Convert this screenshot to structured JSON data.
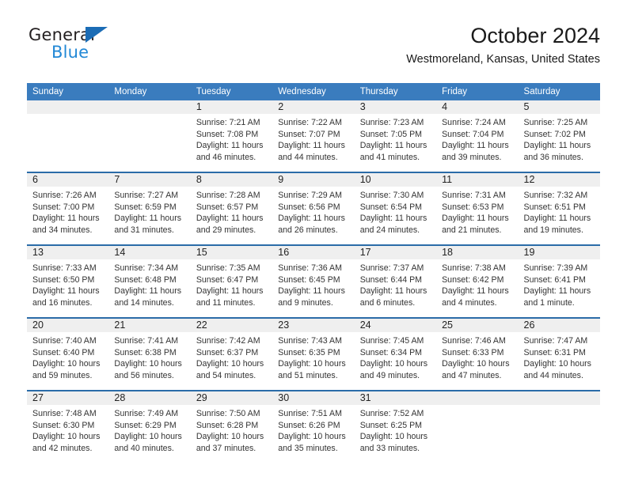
{
  "brand": {
    "name_top": "General",
    "name_bottom": "Blue",
    "triangle_color": "#1b6cb5",
    "blue_text_color": "#2288d6"
  },
  "header": {
    "month_title": "October 2024",
    "location": "Westmoreland, Kansas, United States"
  },
  "theme": {
    "header_band": "#3a7cbe",
    "row_divider": "#2b6ca8",
    "daynum_band": "#efefef"
  },
  "calendar": {
    "weekday_headers": [
      "Sunday",
      "Monday",
      "Tuesday",
      "Wednesday",
      "Thursday",
      "Friday",
      "Saturday"
    ],
    "weeks": [
      [
        {
          "day": "",
          "sunrise": "",
          "sunset": "",
          "daylight_line1": "",
          "daylight_line2": ""
        },
        {
          "day": "",
          "sunrise": "",
          "sunset": "",
          "daylight_line1": "",
          "daylight_line2": ""
        },
        {
          "day": "1",
          "sunrise": "Sunrise: 7:21 AM",
          "sunset": "Sunset: 7:08 PM",
          "daylight_line1": "Daylight: 11 hours",
          "daylight_line2": "and 46 minutes."
        },
        {
          "day": "2",
          "sunrise": "Sunrise: 7:22 AM",
          "sunset": "Sunset: 7:07 PM",
          "daylight_line1": "Daylight: 11 hours",
          "daylight_line2": "and 44 minutes."
        },
        {
          "day": "3",
          "sunrise": "Sunrise: 7:23 AM",
          "sunset": "Sunset: 7:05 PM",
          "daylight_line1": "Daylight: 11 hours",
          "daylight_line2": "and 41 minutes."
        },
        {
          "day": "4",
          "sunrise": "Sunrise: 7:24 AM",
          "sunset": "Sunset: 7:04 PM",
          "daylight_line1": "Daylight: 11 hours",
          "daylight_line2": "and 39 minutes."
        },
        {
          "day": "5",
          "sunrise": "Sunrise: 7:25 AM",
          "sunset": "Sunset: 7:02 PM",
          "daylight_line1": "Daylight: 11 hours",
          "daylight_line2": "and 36 minutes."
        }
      ],
      [
        {
          "day": "6",
          "sunrise": "Sunrise: 7:26 AM",
          "sunset": "Sunset: 7:00 PM",
          "daylight_line1": "Daylight: 11 hours",
          "daylight_line2": "and 34 minutes."
        },
        {
          "day": "7",
          "sunrise": "Sunrise: 7:27 AM",
          "sunset": "Sunset: 6:59 PM",
          "daylight_line1": "Daylight: 11 hours",
          "daylight_line2": "and 31 minutes."
        },
        {
          "day": "8",
          "sunrise": "Sunrise: 7:28 AM",
          "sunset": "Sunset: 6:57 PM",
          "daylight_line1": "Daylight: 11 hours",
          "daylight_line2": "and 29 minutes."
        },
        {
          "day": "9",
          "sunrise": "Sunrise: 7:29 AM",
          "sunset": "Sunset: 6:56 PM",
          "daylight_line1": "Daylight: 11 hours",
          "daylight_line2": "and 26 minutes."
        },
        {
          "day": "10",
          "sunrise": "Sunrise: 7:30 AM",
          "sunset": "Sunset: 6:54 PM",
          "daylight_line1": "Daylight: 11 hours",
          "daylight_line2": "and 24 minutes."
        },
        {
          "day": "11",
          "sunrise": "Sunrise: 7:31 AM",
          "sunset": "Sunset: 6:53 PM",
          "daylight_line1": "Daylight: 11 hours",
          "daylight_line2": "and 21 minutes."
        },
        {
          "day": "12",
          "sunrise": "Sunrise: 7:32 AM",
          "sunset": "Sunset: 6:51 PM",
          "daylight_line1": "Daylight: 11 hours",
          "daylight_line2": "and 19 minutes."
        }
      ],
      [
        {
          "day": "13",
          "sunrise": "Sunrise: 7:33 AM",
          "sunset": "Sunset: 6:50 PM",
          "daylight_line1": "Daylight: 11 hours",
          "daylight_line2": "and 16 minutes."
        },
        {
          "day": "14",
          "sunrise": "Sunrise: 7:34 AM",
          "sunset": "Sunset: 6:48 PM",
          "daylight_line1": "Daylight: 11 hours",
          "daylight_line2": "and 14 minutes."
        },
        {
          "day": "15",
          "sunrise": "Sunrise: 7:35 AM",
          "sunset": "Sunset: 6:47 PM",
          "daylight_line1": "Daylight: 11 hours",
          "daylight_line2": "and 11 minutes."
        },
        {
          "day": "16",
          "sunrise": "Sunrise: 7:36 AM",
          "sunset": "Sunset: 6:45 PM",
          "daylight_line1": "Daylight: 11 hours",
          "daylight_line2": "and 9 minutes."
        },
        {
          "day": "17",
          "sunrise": "Sunrise: 7:37 AM",
          "sunset": "Sunset: 6:44 PM",
          "daylight_line1": "Daylight: 11 hours",
          "daylight_line2": "and 6 minutes."
        },
        {
          "day": "18",
          "sunrise": "Sunrise: 7:38 AM",
          "sunset": "Sunset: 6:42 PM",
          "daylight_line1": "Daylight: 11 hours",
          "daylight_line2": "and 4 minutes."
        },
        {
          "day": "19",
          "sunrise": "Sunrise: 7:39 AM",
          "sunset": "Sunset: 6:41 PM",
          "daylight_line1": "Daylight: 11 hours",
          "daylight_line2": "and 1 minute."
        }
      ],
      [
        {
          "day": "20",
          "sunrise": "Sunrise: 7:40 AM",
          "sunset": "Sunset: 6:40 PM",
          "daylight_line1": "Daylight: 10 hours",
          "daylight_line2": "and 59 minutes."
        },
        {
          "day": "21",
          "sunrise": "Sunrise: 7:41 AM",
          "sunset": "Sunset: 6:38 PM",
          "daylight_line1": "Daylight: 10 hours",
          "daylight_line2": "and 56 minutes."
        },
        {
          "day": "22",
          "sunrise": "Sunrise: 7:42 AM",
          "sunset": "Sunset: 6:37 PM",
          "daylight_line1": "Daylight: 10 hours",
          "daylight_line2": "and 54 minutes."
        },
        {
          "day": "23",
          "sunrise": "Sunrise: 7:43 AM",
          "sunset": "Sunset: 6:35 PM",
          "daylight_line1": "Daylight: 10 hours",
          "daylight_line2": "and 51 minutes."
        },
        {
          "day": "24",
          "sunrise": "Sunrise: 7:45 AM",
          "sunset": "Sunset: 6:34 PM",
          "daylight_line1": "Daylight: 10 hours",
          "daylight_line2": "and 49 minutes."
        },
        {
          "day": "25",
          "sunrise": "Sunrise: 7:46 AM",
          "sunset": "Sunset: 6:33 PM",
          "daylight_line1": "Daylight: 10 hours",
          "daylight_line2": "and 47 minutes."
        },
        {
          "day": "26",
          "sunrise": "Sunrise: 7:47 AM",
          "sunset": "Sunset: 6:31 PM",
          "daylight_line1": "Daylight: 10 hours",
          "daylight_line2": "and 44 minutes."
        }
      ],
      [
        {
          "day": "27",
          "sunrise": "Sunrise: 7:48 AM",
          "sunset": "Sunset: 6:30 PM",
          "daylight_line1": "Daylight: 10 hours",
          "daylight_line2": "and 42 minutes."
        },
        {
          "day": "28",
          "sunrise": "Sunrise: 7:49 AM",
          "sunset": "Sunset: 6:29 PM",
          "daylight_line1": "Daylight: 10 hours",
          "daylight_line2": "and 40 minutes."
        },
        {
          "day": "29",
          "sunrise": "Sunrise: 7:50 AM",
          "sunset": "Sunset: 6:28 PM",
          "daylight_line1": "Daylight: 10 hours",
          "daylight_line2": "and 37 minutes."
        },
        {
          "day": "30",
          "sunrise": "Sunrise: 7:51 AM",
          "sunset": "Sunset: 6:26 PM",
          "daylight_line1": "Daylight: 10 hours",
          "daylight_line2": "and 35 minutes."
        },
        {
          "day": "31",
          "sunrise": "Sunrise: 7:52 AM",
          "sunset": "Sunset: 6:25 PM",
          "daylight_line1": "Daylight: 10 hours",
          "daylight_line2": "and 33 minutes."
        },
        {
          "day": "",
          "sunrise": "",
          "sunset": "",
          "daylight_line1": "",
          "daylight_line2": ""
        },
        {
          "day": "",
          "sunrise": "",
          "sunset": "",
          "daylight_line1": "",
          "daylight_line2": ""
        }
      ]
    ]
  }
}
